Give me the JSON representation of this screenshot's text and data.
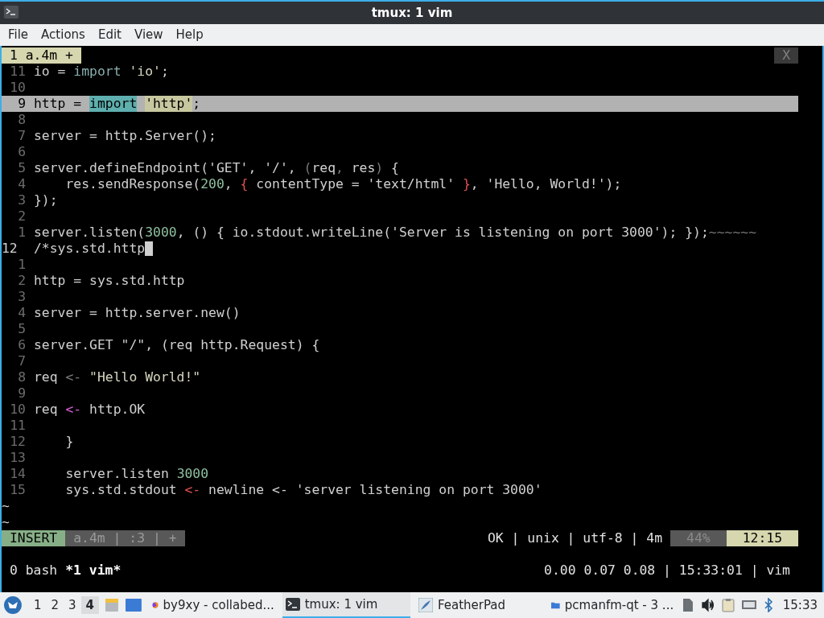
{
  "window": {
    "title": "tmux: 1 vim"
  },
  "menu": [
    "File",
    "Actions",
    "Edit",
    "View",
    "Help"
  ],
  "vim": {
    "tabs": [
      {
        "label": "1 a.4m +",
        "selected": true
      }
    ],
    "close_label": "X",
    "lines": [
      {
        "number": "11",
        "current": false,
        "highlighted": false,
        "segments": [
          {
            "text": "io = ",
            "kind": "plain"
          },
          {
            "text": "import",
            "kind": "keyword"
          },
          {
            "text": "'io'",
            "kind": "string",
            "spaced": true
          },
          {
            "text": ";",
            "kind": "plain"
          }
        ]
      },
      {
        "number": "10",
        "current": false,
        "highlighted": false
      },
      {
        "number": "9",
        "current": false,
        "highlighted": true,
        "segments": [
          {
            "text": "http = ",
            "kind": "plain"
          },
          {
            "text": "import",
            "kind": "keyword"
          },
          {
            "text": "'http'",
            "kind": "string",
            "spaced": true
          },
          {
            "text": ";",
            "kind": "plain"
          }
        ]
      },
      {
        "number": "8",
        "current": false,
        "highlighted": false
      },
      {
        "number": "7",
        "current": false,
        "highlighted": false,
        "segments": [
          {
            "text": "server = http.Server();",
            "kind": "plain"
          }
        ]
      },
      {
        "number": "6",
        "current": false,
        "highlighted": false
      },
      {
        "number": "5",
        "current": false,
        "highlighted": false,
        "segments": [
          {
            "text": "server.defineEndpoint('GET', '/', ",
            "kind": "plain"
          },
          {
            "text": "(",
            "kind": "dim"
          },
          {
            "text": "req",
            "kind": "plain"
          },
          {
            "text": ",",
            "kind": "dim"
          },
          {
            "text": " res",
            "kind": "plain"
          },
          {
            "text": ")",
            "kind": "dim"
          },
          {
            "text": " {",
            "kind": "plain"
          }
        ]
      },
      {
        "number": "4",
        "current": false,
        "highlighted": false,
        "segments": [
          {
            "text": "    res.sendResponse(",
            "kind": "plain"
          },
          {
            "text": "200",
            "kind": "number"
          },
          {
            "text": ", ",
            "kind": "plain"
          },
          {
            "text": "{",
            "kind": "red"
          },
          {
            "text": " contentType = 'text/html' ",
            "kind": "plain"
          },
          {
            "text": "}",
            "kind": "red"
          },
          {
            "text": ", 'Hello, World!');",
            "kind": "plain"
          }
        ]
      },
      {
        "number": "3",
        "current": false,
        "highlighted": false,
        "segments": [
          {
            "text": "});",
            "kind": "plain"
          }
        ]
      },
      {
        "number": "2",
        "current": false,
        "highlighted": false
      },
      {
        "number": "1",
        "current": false,
        "highlighted": false,
        "segments": [
          {
            "text": "server.listen(",
            "kind": "plain"
          },
          {
            "text": "3000",
            "kind": "number"
          },
          {
            "text": ", () { io.stdout.writeLine('Server is listening on port 3000'); });",
            "kind": "plain"
          },
          {
            "text": "~~~~~~",
            "kind": "dim"
          }
        ]
      },
      {
        "number": "12",
        "current": true,
        "highlighted": false,
        "segments": [
          {
            "text": "/*sys.std.http",
            "kind": "plain"
          }
        ]
      },
      {
        "number": "1",
        "current": false,
        "highlighted": false
      },
      {
        "number": "2",
        "current": false,
        "highlighted": false,
        "segments": [
          {
            "text": "http = sys.std.http",
            "kind": "plain"
          }
        ]
      },
      {
        "number": "3",
        "current": false,
        "highlighted": false
      },
      {
        "number": "4",
        "current": false,
        "highlighted": false,
        "segments": [
          {
            "text": "server = http.server.new()",
            "kind": "plain"
          }
        ]
      },
      {
        "number": "5",
        "current": false,
        "highlighted": false
      },
      {
        "number": "6",
        "current": false,
        "highlighted": false,
        "segments": [
          {
            "text": "server.GET \"/\", (req http.Request) {",
            "kind": "plain"
          }
        ]
      },
      {
        "number": "7",
        "current": false,
        "highlighted": false
      },
      {
        "number": "8",
        "current": false,
        "highlighted": false,
        "segments": [
          {
            "text": "req ",
            "kind": "plain"
          },
          {
            "text": "<-",
            "kind": "dim"
          },
          {
            "text": "\"Hello World!\"",
            "kind": "string",
            "spaced": true
          }
        ]
      },
      {
        "number": "9",
        "current": false,
        "highlighted": false
      },
      {
        "number": "10",
        "current": false,
        "highlighted": false,
        "segments": [
          {
            "text": "req ",
            "kind": "plain"
          },
          {
            "text": "<-",
            "kind": "magenta"
          },
          {
            "text": " http.OK",
            "kind": "plain"
          }
        ]
      },
      {
        "number": "11",
        "current": false,
        "highlighted": false
      },
      {
        "number": "12",
        "current": false,
        "highlighted": false,
        "segments": [
          {
            "text": "    }",
            "kind": "plain"
          }
        ]
      },
      {
        "number": "13",
        "current": false,
        "highlighted": false
      },
      {
        "number": "14",
        "current": false,
        "highlighted": false,
        "segments": [
          {
            "text": "    server.listen ",
            "kind": "plain"
          },
          {
            "text": "3000",
            "kind": "number"
          }
        ]
      },
      {
        "number": "15",
        "current": false,
        "highlighted": false,
        "segments": [
          {
            "text": "    sys.std.stdout ",
            "kind": "plain"
          },
          {
            "text": "<-",
            "kind": "red"
          },
          {
            "text": " newline <- 'server listening on port 3000'",
            "kind": "plain"
          }
        ]
      }
    ],
    "tildes": [
      "~",
      "~"
    ],
    "statusline": {
      "mode": "INSERT",
      "left": "a.4m | :3 | +",
      "info": "OK | unix | utf-8 | 4m",
      "percent": "44%",
      "position": "12:15"
    }
  },
  "tmux": {
    "windows": [
      {
        "label": "0 bash",
        "selected": false
      },
      {
        "label": "*1 vim*",
        "selected": true
      }
    ],
    "right": "0.00 0.07 0.08 | 15:33:01 | vim"
  },
  "taskbar": {
    "desktops": [
      {
        "label": "1",
        "selected": false
      },
      {
        "label": "2",
        "selected": false
      },
      {
        "label": "3",
        "selected": false
      },
      {
        "label": "4",
        "selected": true
      }
    ],
    "tasks": [
      {
        "label": "by9xy - collabed...",
        "kind": "browser",
        "selected": false
      },
      {
        "label": "tmux: 1 vim",
        "kind": "terminal",
        "selected": true
      },
      {
        "label": "FeatherPad",
        "kind": "editor",
        "selected": false
      },
      {
        "label": "pcmanfm-qt - 3 ...",
        "kind": "folder",
        "selected": false
      }
    ],
    "clock": "15:33"
  }
}
